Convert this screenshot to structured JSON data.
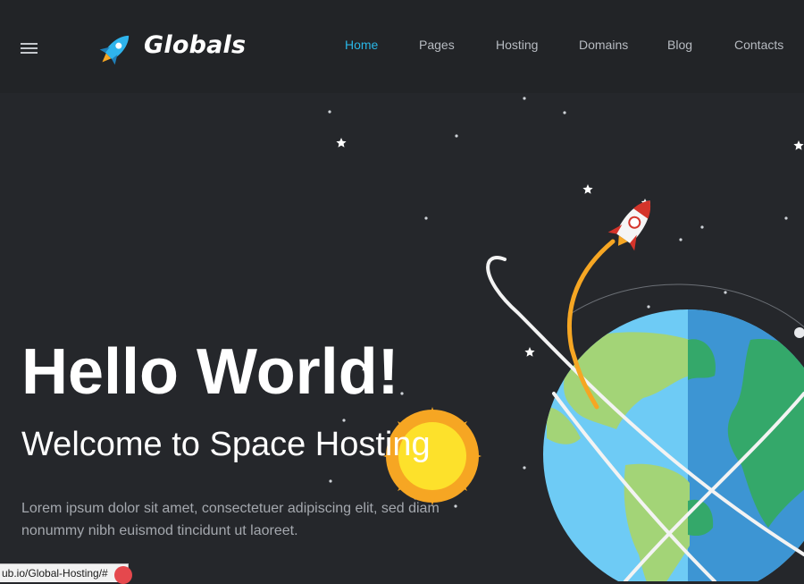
{
  "brand": {
    "name": "Globals",
    "icon": "rocket-icon"
  },
  "menu": {
    "icon": "hamburger-menu-icon"
  },
  "nav": {
    "items": [
      {
        "label": "Home",
        "active": true
      },
      {
        "label": "Pages",
        "active": false
      },
      {
        "label": "Hosting",
        "active": false
      },
      {
        "label": "Domains",
        "active": false
      },
      {
        "label": "Blog",
        "active": false
      },
      {
        "label": "Contacts",
        "active": false
      }
    ]
  },
  "hero": {
    "title": "Hello World!",
    "subtitle": "Welcome to Space Hosting",
    "description": "Lorem ipsum dolor sit amet, consectetuer adipiscing elit, sed diam nonummy nibh euismod tincidunt ut laoreet."
  },
  "status_bar": {
    "url": "ub.io/Global-Hosting/#"
  },
  "colors": {
    "background": "#25272b",
    "header": "#222427",
    "accent": "#29b6e6",
    "nav_text": "#b7bbc1",
    "ocean": "#6ecbf5",
    "ocean_dark": "#3d95d3",
    "land": "#a3d477",
    "land_dark": "#34a86a",
    "sun": "#fde12b",
    "sun_rays": "#f6a623"
  }
}
